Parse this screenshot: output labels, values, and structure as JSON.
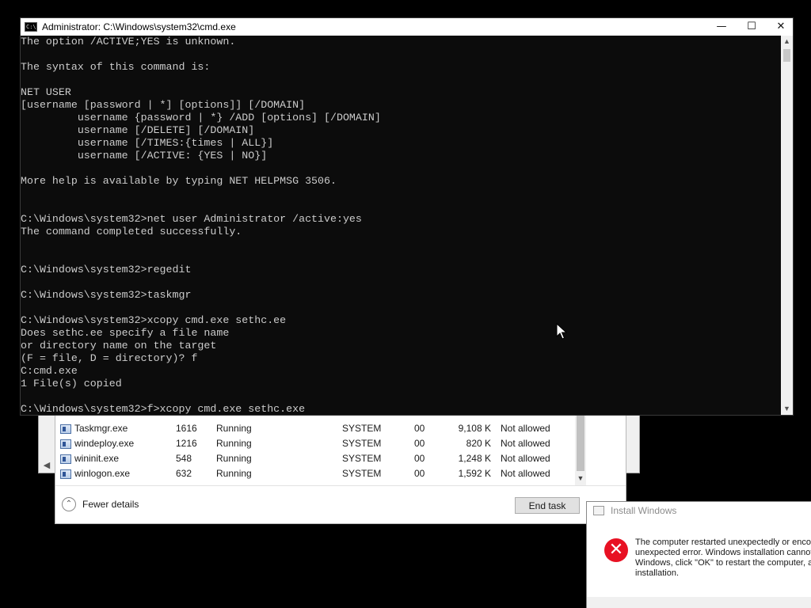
{
  "cmd": {
    "title": "Administrator: C:\\Windows\\system32\\cmd.exe",
    "controls": {
      "minimize": "—",
      "maximize": "☐",
      "close": "✕"
    },
    "lines": [
      "The option /ACTIVE;YES is unknown.",
      "",
      "The syntax of this command is:",
      "",
      "NET USER",
      "[username [password | *] [options]] [/DOMAIN]",
      "         username {password | *} /ADD [options] [/DOMAIN]",
      "         username [/DELETE] [/DOMAIN]",
      "         username [/TIMES:{times | ALL}]",
      "         username [/ACTIVE: {YES | NO}]",
      "",
      "More help is available by typing NET HELPMSG 3506.",
      "",
      "",
      "C:\\Windows\\system32>net user Administrator /active:yes",
      "The command completed successfully.",
      "",
      "",
      "C:\\Windows\\system32>regedit",
      "",
      "C:\\Windows\\system32>taskmgr",
      "",
      "C:\\Windows\\system32>xcopy cmd.exe sethc.ee",
      "Does sethc.ee specify a file name",
      "or directory name on the target",
      "(F = file, D = directory)? f",
      "C:cmd.exe",
      "1 File(s) copied",
      "",
      "C:\\Windows\\system32>f>xcopy cmd.exe sethc.exe"
    ]
  },
  "taskmgr": {
    "processes": [
      {
        "name": "Taskmgr.exe",
        "pid": "1616",
        "status": "Running",
        "user": "SYSTEM",
        "cpu": "00",
        "memory": "9,108 K",
        "uac": "Not allowed"
      },
      {
        "name": "windeploy.exe",
        "pid": "1216",
        "status": "Running",
        "user": "SYSTEM",
        "cpu": "00",
        "memory": "820 K",
        "uac": "Not allowed"
      },
      {
        "name": "wininit.exe",
        "pid": "548",
        "status": "Running",
        "user": "SYSTEM",
        "cpu": "00",
        "memory": "1,248 K",
        "uac": "Not allowed"
      },
      {
        "name": "winlogon.exe",
        "pid": "632",
        "status": "Running",
        "user": "SYSTEM",
        "cpu": "00",
        "memory": "1,592 K",
        "uac": "Not allowed"
      }
    ],
    "fewer_details": "Fewer details",
    "end_task": "End task"
  },
  "install_dialog": {
    "title": "Install Windows",
    "message_lines": [
      "The computer restarted unexpectedly or encou",
      "unexpected error. Windows installation cannot p",
      "Windows, click \"OK\" to restart the computer, ar",
      "installation."
    ]
  },
  "colors": {
    "console_bg": "#0c0c0c",
    "console_fg": "#cccccc",
    "error_red": "#e81123"
  }
}
